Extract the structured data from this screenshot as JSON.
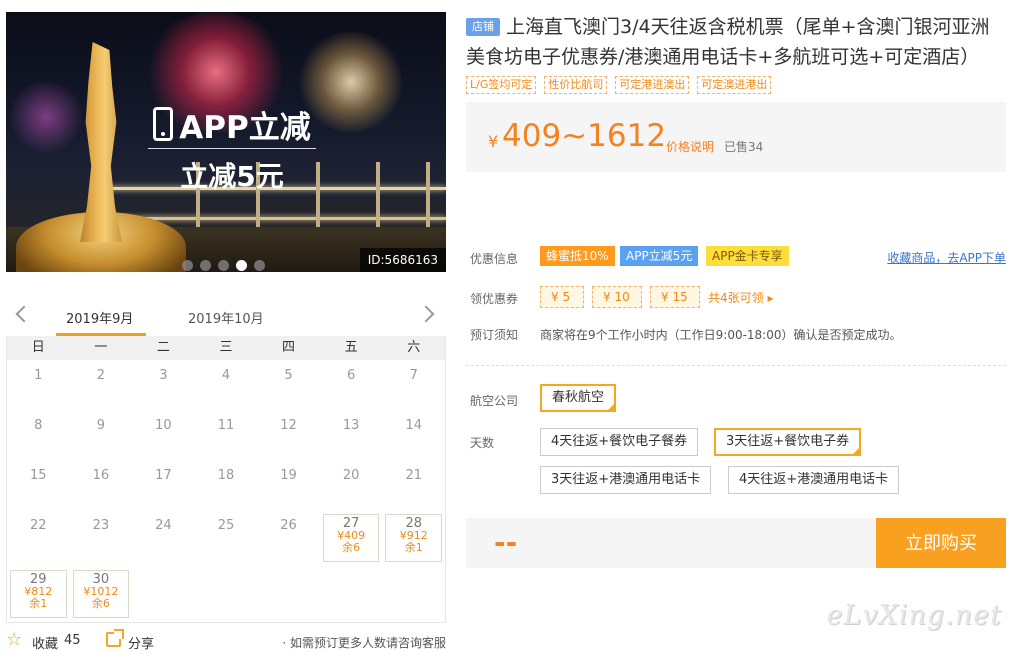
{
  "hero": {
    "promo_line1": "APP立减",
    "promo_line2": "立减5元",
    "id_label": "ID:5686163",
    "slides": 5,
    "active_slide": 4
  },
  "calendar": {
    "months": [
      "2019年9月",
      "2019年10月"
    ],
    "weekdays": [
      "日",
      "一",
      "二",
      "三",
      "四",
      "五",
      "六"
    ],
    "weeks": [
      [
        {
          "d": "1"
        },
        {
          "d": "2"
        },
        {
          "d": "3"
        },
        {
          "d": "4"
        },
        {
          "d": "5"
        },
        {
          "d": "6"
        },
        {
          "d": "7"
        }
      ],
      [
        {
          "d": "8"
        },
        {
          "d": "9"
        },
        {
          "d": "10"
        },
        {
          "d": "11"
        },
        {
          "d": "12"
        },
        {
          "d": "13"
        },
        {
          "d": "14"
        }
      ],
      [
        {
          "d": "15"
        },
        {
          "d": "16"
        },
        {
          "d": "17"
        },
        {
          "d": "18"
        },
        {
          "d": "19"
        },
        {
          "d": "20"
        },
        {
          "d": "21"
        }
      ],
      [
        {
          "d": "22"
        },
        {
          "d": "23"
        },
        {
          "d": "24"
        },
        {
          "d": "25"
        },
        {
          "d": "26"
        },
        {
          "d": "27",
          "p": "¥409",
          "r": "余6"
        },
        {
          "d": "28",
          "p": "¥912",
          "r": "余1"
        }
      ],
      [
        {
          "d": "29",
          "p": "¥812",
          "r": "余1"
        },
        {
          "d": "30",
          "p": "¥1012",
          "r": "余6"
        },
        {},
        {},
        {},
        {},
        {}
      ]
    ]
  },
  "footer": {
    "fav_label": "收藏",
    "fav_count": "45",
    "share_label": "分享",
    "contact_note": "· 如需预订更多人数请咨询客服"
  },
  "product": {
    "store_badge": "店铺",
    "title": "上海直飞澳门3/4天往返含税机票（尾单+含澳门银河亚洲美食坊电子优惠券/港澳通用电话卡+多航班可选+可定酒店）",
    "tags": [
      "L/G签均可定",
      "性价比航司",
      "可定港进澳出",
      "可定澳进港出"
    ],
    "price_symbol": "¥",
    "price": "409~1612",
    "price_note": "价格说明",
    "sold": "已售34"
  },
  "offers": {
    "promo_label": "优惠信息",
    "badges": [
      "蜂蜜抵10%",
      "APP立减5元",
      "APP金卡专享"
    ],
    "fav_link": "收藏商品，去APP下单",
    "coupon_label": "领优惠券",
    "coupons": [
      "¥ 5",
      "¥ 10",
      "¥ 15"
    ],
    "coupon_count": "共4张可领 ▸",
    "notice_label": "预订须知",
    "notice_text": "商家将在9个工作小时内（工作日9:00-18:00）确认是否预定成功。"
  },
  "options": {
    "airline_label": "航空公司",
    "airline": "春秋航空",
    "days_label": "天数",
    "days": [
      "4天往返+餐饮电子餐券",
      "3天往返+餐饮电子券",
      "3天往返+港澳通用电话卡",
      "4天往返+港澳通用电话卡"
    ],
    "selected_day": 1
  },
  "buy": {
    "total": "--",
    "button": "立即购买"
  },
  "watermark": "eLvXing.net"
}
